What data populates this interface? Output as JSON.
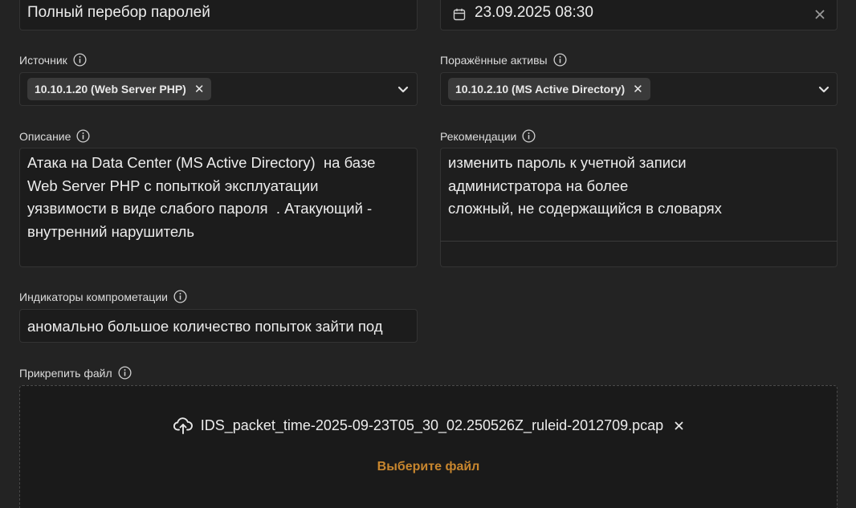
{
  "title_field": {
    "value": "Полный перебор паролей"
  },
  "datetime_field": {
    "value": "23.09.2025 08:30",
    "icon": "calendar-icon",
    "clear_icon": "close-icon"
  },
  "source": {
    "label": "Источник",
    "chips": [
      {
        "text": "10.10.1.20 (Web Server PHP)"
      }
    ]
  },
  "affected_assets": {
    "label": "Поражённые активы",
    "chips": [
      {
        "text": "10.10.2.10 (MS Active Directory)"
      }
    ]
  },
  "description": {
    "label": "Описание",
    "lines": [
      "Атака на Data Center (MS Active Directory)  на базе",
      "Web Server PHP с попыткой эксплуатации",
      "уязвимости в виде слабого пароля  . Атакующий -",
      "внутренний нарушитель"
    ]
  },
  "recommendations": {
    "label": "Рекомендации",
    "lines": [
      "изменить пароль к учетной записи",
      "администратора на более",
      "сложный, не содержащийся в словарях"
    ]
  },
  "ioc": {
    "label": "Индикаторы компрометации",
    "value": "аномально большое количество попыток зайти под"
  },
  "attach": {
    "label": "Прикрепить файл",
    "file_name": "IDS_packet_time-2025-09-23T05_30_02.250526Z_ruleid-2012709.pcap",
    "choose_label": "Выберите файл"
  },
  "colors": {
    "background": "#232323",
    "field_bg": "#1c1c1c",
    "chip_bg": "#3a3a3a",
    "accent": "#c8862e"
  }
}
